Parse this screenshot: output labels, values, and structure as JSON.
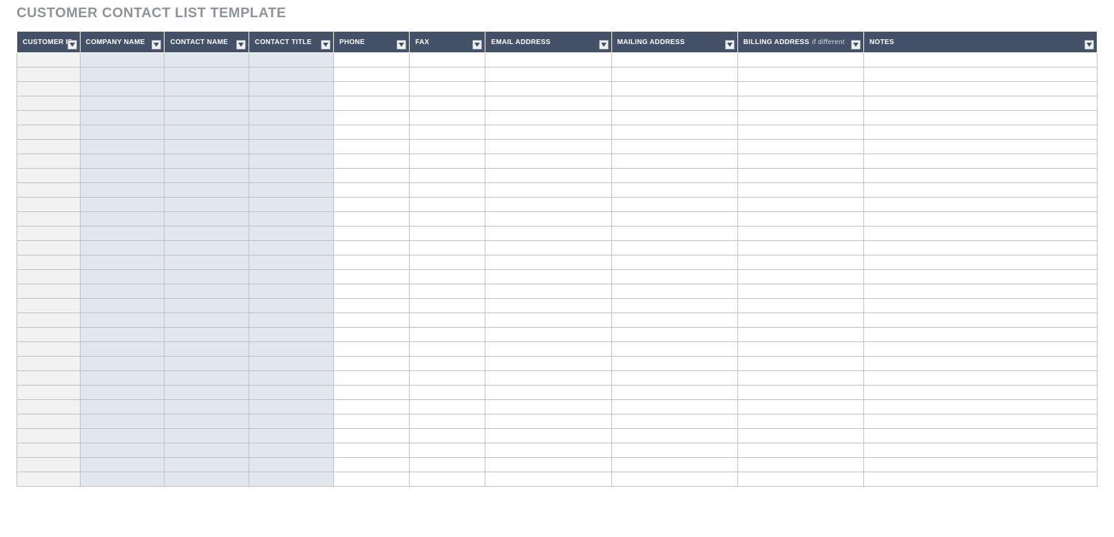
{
  "title": "CUSTOMER CONTACT LIST TEMPLATE",
  "columns": [
    {
      "label": "CUSTOMER ID",
      "sub": "",
      "shade": "a"
    },
    {
      "label": "COMPANY NAME",
      "sub": "",
      "shade": "b"
    },
    {
      "label": "CONTACT NAME",
      "sub": "",
      "shade": "b"
    },
    {
      "label": "CONTACT TITLE",
      "sub": "",
      "shade": "b"
    },
    {
      "label": "PHONE",
      "sub": "",
      "shade": ""
    },
    {
      "label": "FAX",
      "sub": "",
      "shade": ""
    },
    {
      "label": "EMAIL ADDRESS",
      "sub": "",
      "shade": ""
    },
    {
      "label": "MAILING ADDRESS",
      "sub": "",
      "shade": ""
    },
    {
      "label": "BILLING ADDRESS",
      "sub": "if different",
      "shade": ""
    },
    {
      "label": "NOTES",
      "sub": "",
      "shade": ""
    }
  ],
  "rows": [
    [
      "",
      "",
      "",
      "",
      "",
      "",
      "",
      "",
      "",
      ""
    ],
    [
      "",
      "",
      "",
      "",
      "",
      "",
      "",
      "",
      "",
      ""
    ],
    [
      "",
      "",
      "",
      "",
      "",
      "",
      "",
      "",
      "",
      ""
    ],
    [
      "",
      "",
      "",
      "",
      "",
      "",
      "",
      "",
      "",
      ""
    ],
    [
      "",
      "",
      "",
      "",
      "",
      "",
      "",
      "",
      "",
      ""
    ],
    [
      "",
      "",
      "",
      "",
      "",
      "",
      "",
      "",
      "",
      ""
    ],
    [
      "",
      "",
      "",
      "",
      "",
      "",
      "",
      "",
      "",
      ""
    ],
    [
      "",
      "",
      "",
      "",
      "",
      "",
      "",
      "",
      "",
      ""
    ],
    [
      "",
      "",
      "",
      "",
      "",
      "",
      "",
      "",
      "",
      ""
    ],
    [
      "",
      "",
      "",
      "",
      "",
      "",
      "",
      "",
      "",
      ""
    ],
    [
      "",
      "",
      "",
      "",
      "",
      "",
      "",
      "",
      "",
      ""
    ],
    [
      "",
      "",
      "",
      "",
      "",
      "",
      "",
      "",
      "",
      ""
    ],
    [
      "",
      "",
      "",
      "",
      "",
      "",
      "",
      "",
      "",
      ""
    ],
    [
      "",
      "",
      "",
      "",
      "",
      "",
      "",
      "",
      "",
      ""
    ],
    [
      "",
      "",
      "",
      "",
      "",
      "",
      "",
      "",
      "",
      ""
    ],
    [
      "",
      "",
      "",
      "",
      "",
      "",
      "",
      "",
      "",
      ""
    ],
    [
      "",
      "",
      "",
      "",
      "",
      "",
      "",
      "",
      "",
      ""
    ],
    [
      "",
      "",
      "",
      "",
      "",
      "",
      "",
      "",
      "",
      ""
    ],
    [
      "",
      "",
      "",
      "",
      "",
      "",
      "",
      "",
      "",
      ""
    ],
    [
      "",
      "",
      "",
      "",
      "",
      "",
      "",
      "",
      "",
      ""
    ],
    [
      "",
      "",
      "",
      "",
      "",
      "",
      "",
      "",
      "",
      ""
    ],
    [
      "",
      "",
      "",
      "",
      "",
      "",
      "",
      "",
      "",
      ""
    ],
    [
      "",
      "",
      "",
      "",
      "",
      "",
      "",
      "",
      "",
      ""
    ],
    [
      "",
      "",
      "",
      "",
      "",
      "",
      "",
      "",
      "",
      ""
    ],
    [
      "",
      "",
      "",
      "",
      "",
      "",
      "",
      "",
      "",
      ""
    ],
    [
      "",
      "",
      "",
      "",
      "",
      "",
      "",
      "",
      "",
      ""
    ],
    [
      "",
      "",
      "",
      "",
      "",
      "",
      "",
      "",
      "",
      ""
    ],
    [
      "",
      "",
      "",
      "",
      "",
      "",
      "",
      "",
      "",
      ""
    ],
    [
      "",
      "",
      "",
      "",
      "",
      "",
      "",
      "",
      "",
      ""
    ],
    [
      "",
      "",
      "",
      "",
      "",
      "",
      "",
      "",
      "",
      ""
    ]
  ]
}
